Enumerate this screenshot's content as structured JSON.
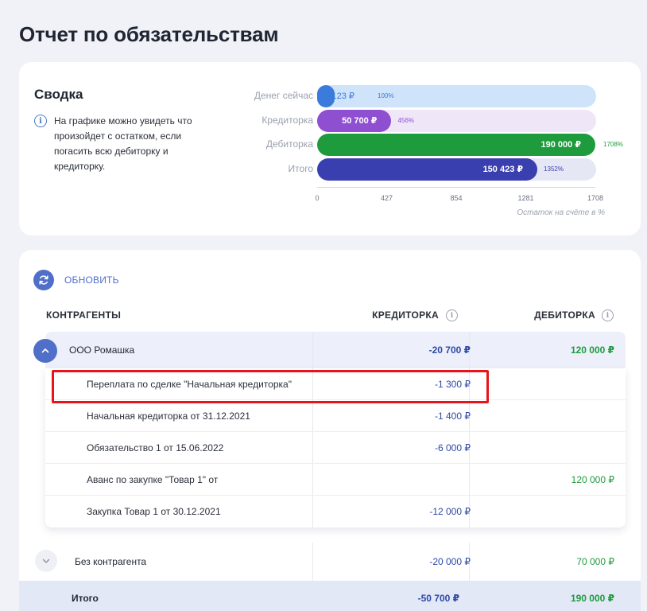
{
  "page_title": "Отчет по обязательствам",
  "summary": {
    "title": "Сводка",
    "info_text": "На графике можно увидеть что произойдет с остатком, если погасить всю дебиторку и кредиторку."
  },
  "chart_data": {
    "type": "bar",
    "orientation": "horizontal",
    "categories": [
      "Денег сейчас",
      "Кредиторка",
      "Дебиторка",
      "Итого"
    ],
    "values": [
      100,
      456,
      1708,
      1352
    ],
    "value_labels": [
      "11 123 ₽",
      "50 700 ₽",
      "190 000 ₽",
      "150 423 ₽"
    ],
    "percent_labels": [
      "100%",
      "456%",
      "1708%",
      "1352%"
    ],
    "xlim": [
      0,
      1708
    ],
    "xticks": [
      "0",
      "427",
      "854",
      "1281",
      "1708"
    ],
    "xlabel": "Остаток на счёте в %",
    "colors": {
      "fill": [
        "#3b7bdc",
        "#8f4fd1",
        "#1e9b3c",
        "#3a3fb0"
      ],
      "track": [
        "#cfe3fb",
        "#efe6f8",
        "#ffffff",
        "#e6e7f5"
      ],
      "pct": [
        "#3b7bdc",
        "#8f4fd1",
        "#1e9b3c",
        "#3a3fb0"
      ]
    }
  },
  "toolbar": {
    "refresh_label": "ОБНОВИТЬ"
  },
  "table": {
    "headers": {
      "name": "КОНТРАГЕНТЫ",
      "credit": "КРЕДИТОРКА",
      "debit": "ДЕБИТОРКА"
    },
    "group": {
      "name": "ООО Ромашка",
      "credit": "-20 700 ₽",
      "debit": "120 000 ₽"
    },
    "children": [
      {
        "name": "Переплата по сделке \"Начальная кредиторка\"",
        "credit": "-1 300 ₽",
        "debit": ""
      },
      {
        "name": "Начальная кредиторка от 31.12.2021",
        "credit": "-1 400 ₽",
        "debit": ""
      },
      {
        "name": "Обязательство 1 от 15.06.2022",
        "credit": "-6 000 ₽",
        "debit": ""
      },
      {
        "name": "Аванс по закупке \"Товар 1\" от",
        "credit": "",
        "debit": "120 000 ₽"
      },
      {
        "name": "Закупка Товар 1 от 30.12.2021",
        "credit": "-12 000 ₽",
        "debit": ""
      }
    ],
    "other": {
      "name": "Без контрагента",
      "credit": "-20 000 ₽",
      "debit": "70 000 ₽"
    },
    "total": {
      "name": "Итого",
      "credit": "-50 700 ₽",
      "debit": "190 000 ₽"
    }
  },
  "icons": {
    "info": "info-icon",
    "refresh": "refresh-icon",
    "collapse": "chevron-up-icon",
    "expand": "chevron-down-icon"
  },
  "colors": {
    "accent": "#4f6fc9",
    "credit_text": "#2d49a6",
    "debit_text": "#1e9b3c",
    "highlight": "#e8141a"
  }
}
